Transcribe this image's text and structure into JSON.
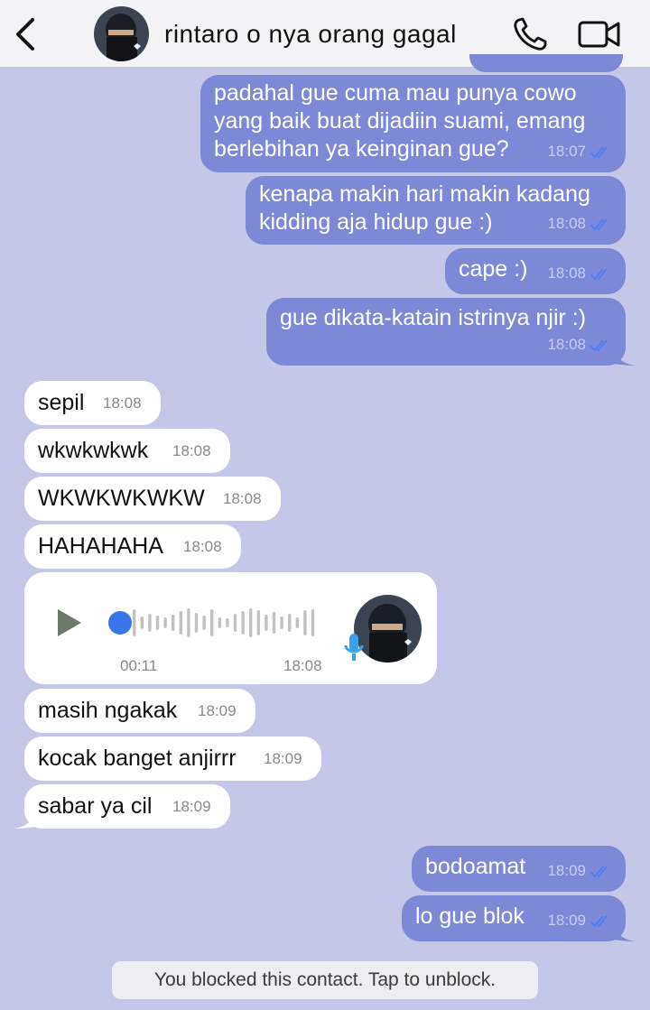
{
  "header": {
    "contact_name": "rintaro o nya orang gagal",
    "icons": [
      "chevron-left-icon",
      "phone-icon",
      "video-camera-icon"
    ]
  },
  "messages": {
    "m1": {
      "text": "padahal gue cuma mau punya cowo\nyang baik buat dijadiin suami, emang\nberlebihan ya keinginan gue?",
      "time": "18:07"
    },
    "m2": {
      "text": "kenapa makin hari makin kadang\nkidding aja hidup gue :)",
      "time": "18:08"
    },
    "m3": {
      "text": "cape :)",
      "time": "18:08"
    },
    "m4": {
      "text": "gue dikata-katain istrinya njir :)",
      "time": "18:08"
    },
    "m5": {
      "text": "sepil",
      "time": "18:08"
    },
    "m6": {
      "text": "wkwkwkwk",
      "time": "18:08"
    },
    "m7": {
      "text": "WKWKWKWKW",
      "time": "18:08"
    },
    "m8": {
      "text": "HAHAHAHA",
      "time": "18:08"
    },
    "m9": {
      "text": "masih ngakak",
      "time": "18:09"
    },
    "m10": {
      "text": "kocak banget anjirrr",
      "time": "18:09"
    },
    "m11": {
      "text": "sabar ya cil",
      "time": "18:09"
    },
    "m12": {
      "text": "bodoamat",
      "time": "18:09"
    },
    "m13": {
      "text": "lo gue blok",
      "time": "18:09"
    }
  },
  "voice": {
    "duration": "00:11",
    "time": "18:08",
    "progress": 0
  },
  "blocked_notice": "You blocked this contact. Tap to unblock.",
  "colors": {
    "background": "#c4c7e8",
    "outgoing_bubble": "#7d88d6",
    "incoming_bubble": "#ffffff",
    "read_tick": "#4f7ef0"
  }
}
